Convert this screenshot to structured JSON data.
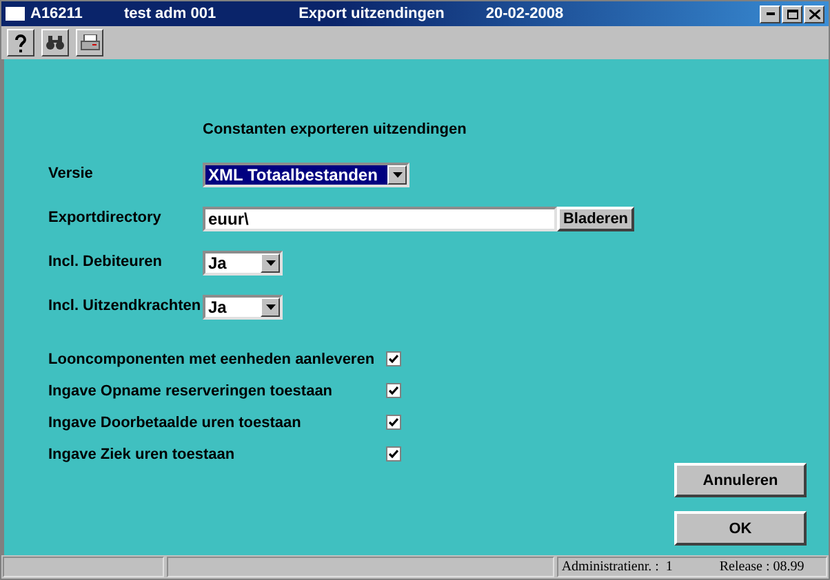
{
  "window": {
    "title_parts": [
      "A16211",
      "test adm 001",
      "Export uitzendingen",
      "20-02-2008"
    ]
  },
  "form": {
    "heading": "Constanten exporteren uitzendingen",
    "fields": [
      {
        "kind": "select",
        "label": "Versie",
        "value": "XML Totaalbestanden",
        "highlighted": true
      },
      {
        "kind": "text",
        "label": "Exportdirectory",
        "value": "euur\\",
        "button": "Bladeren"
      },
      {
        "kind": "select",
        "label": "Incl. Debiteuren",
        "value": "Ja",
        "highlighted": false
      },
      {
        "kind": "select",
        "label": "Incl. Uitzendkrachten",
        "value": "Ja",
        "highlighted": false
      }
    ],
    "options": [
      {
        "label": "Looncomponenten met eenheden aanleveren",
        "checked": true
      },
      {
        "label": "Ingave Opname reserveringen toestaan",
        "checked": true
      },
      {
        "label": "Ingave Doorbetaalde uren toestaan",
        "checked": true
      },
      {
        "label": "Ingave Ziek uren toestaan",
        "checked": true
      }
    ]
  },
  "buttons": [
    "Annuleren",
    "OK"
  ],
  "status_bar": [
    "Administratienr. :  1",
    "Release : 08.99"
  ]
}
